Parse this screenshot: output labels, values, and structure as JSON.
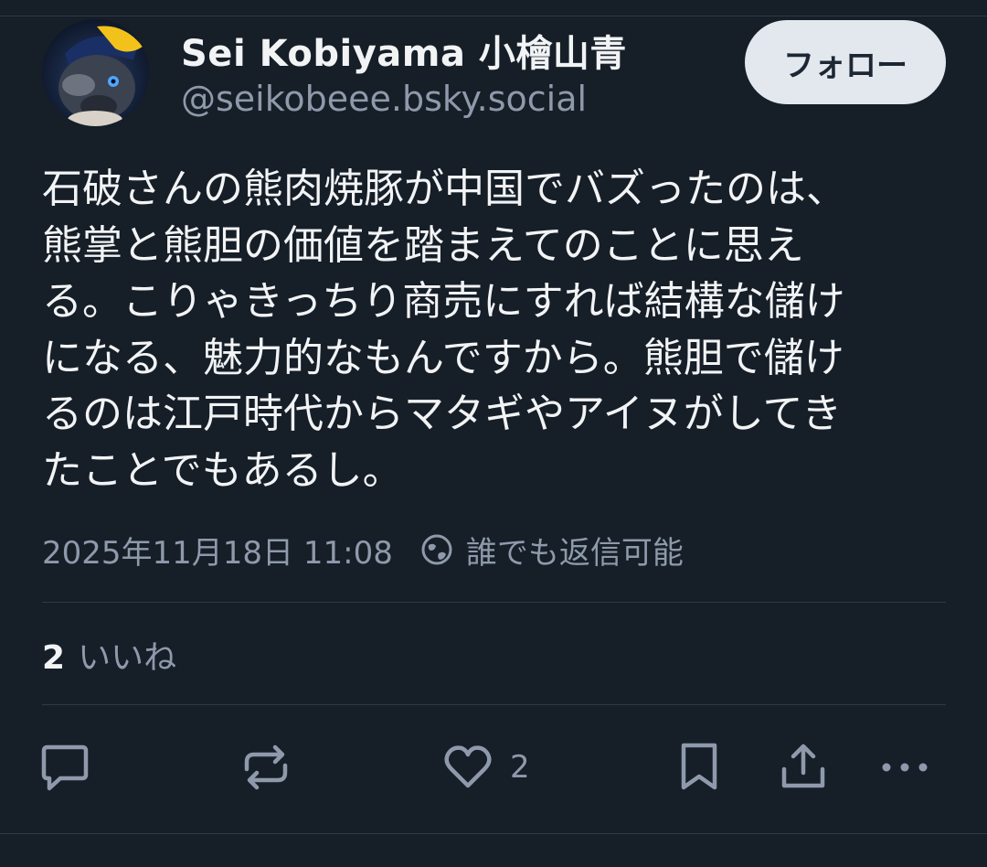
{
  "author": {
    "display_name": "Sei Kobiyama 小檜山青",
    "handle": "@seikobeee.bsky.social",
    "avatar_icon": "cat-avatar-icon"
  },
  "follow_button": {
    "label": "フォロー"
  },
  "post": {
    "lines": [
      "石破さんの熊肉焼豚が中国でバズったのは、",
      "熊掌と熊胆の価値を踏まえてのことに思え",
      "る。こりゃきっちり商売にすれば結構な儲け",
      "になる、魅力的なもんですから。熊胆で儲け",
      "るのは江戸時代からマタギやアイヌがしてき",
      "たことでもあるし。"
    ],
    "timestamp": "2025年11月18日 11:08",
    "reply_setting": "誰でも返信可能"
  },
  "stats": {
    "likes_count": "2",
    "likes_label": "いいね"
  },
  "actions": {
    "reply_icon": "reply-icon",
    "repost_icon": "repost-icon",
    "like_icon": "heart-icon",
    "like_count": "2",
    "bookmark_icon": "bookmark-icon",
    "share_icon": "share-icon",
    "more_icon": "more-icon"
  },
  "colors": {
    "background": "#161e27",
    "text_primary": "#f1f3f5",
    "text_secondary": "#8e9aab",
    "button_bg": "#e3e8ef"
  }
}
